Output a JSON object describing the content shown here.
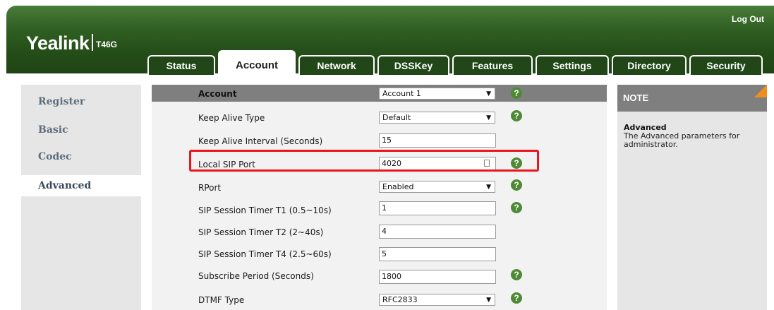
{
  "header": {
    "brand": "Yealink",
    "model": "T46G",
    "logout": "Log Out",
    "tabs": [
      {
        "label": "Status"
      },
      {
        "label": "Account"
      },
      {
        "label": "Network"
      },
      {
        "label": "DSSKey"
      },
      {
        "label": "Features"
      },
      {
        "label": "Settings"
      },
      {
        "label": "Directory"
      },
      {
        "label": "Security"
      }
    ],
    "active_tab": "Account"
  },
  "sidebar": {
    "items": [
      {
        "label": "Register"
      },
      {
        "label": "Basic"
      },
      {
        "label": "Codec"
      },
      {
        "label": "Advanced"
      }
    ],
    "active": "Advanced"
  },
  "form": {
    "header_label": "Account",
    "account_select": "Account 1",
    "rows": [
      {
        "label": "Keep Alive Type",
        "value": "Default"
      },
      {
        "label": "Keep Alive Interval (Seconds)",
        "value": "15"
      },
      {
        "label": "Local SIP Port",
        "value": "4020"
      },
      {
        "label": "RPort",
        "value": "Enabled"
      },
      {
        "label": "SIP Session Timer T1 (0.5~10s)",
        "value": "1"
      },
      {
        "label": "SIP Session Timer T2 (2~40s)",
        "value": "4"
      },
      {
        "label": "SIP Session Timer T4 (2.5~60s)",
        "value": "5"
      },
      {
        "label": "Subscribe Period (Seconds)",
        "value": "1800"
      },
      {
        "label": "DTMF Type",
        "value": "RFC2833"
      }
    ],
    "help_glyph": "?"
  },
  "note": {
    "title": "NOTE",
    "subtitle": "Advanced",
    "description": "The Advanced parameters for administrator."
  },
  "colors": {
    "header_green": "#2f5f22",
    "help_green": "#4e8a35",
    "highlight_red": "#e8161e",
    "note_corner": "#f28f1c"
  }
}
